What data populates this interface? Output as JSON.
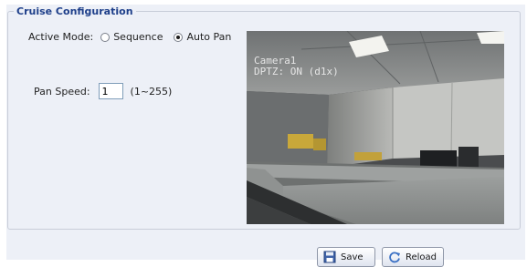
{
  "section": {
    "title": "Cruise Configuration"
  },
  "active_mode": {
    "label": "Active Mode:",
    "options": [
      "Sequence",
      "Auto Pan"
    ],
    "selected": "Auto Pan"
  },
  "pan_speed": {
    "label": "Pan Speed:",
    "value": "1",
    "range": "(1~255)"
  },
  "camera": {
    "name": "Camera1",
    "status": "DPTZ: ON (d1x)"
  },
  "buttons": {
    "save": "Save",
    "reload": "Reload"
  },
  "icons": {
    "save": "save-disk-icon",
    "reload": "reload-icon"
  },
  "colors": {
    "legend": "#1e3f8a",
    "panel": "#edf0f7",
    "field_border": "#7f9db9"
  }
}
